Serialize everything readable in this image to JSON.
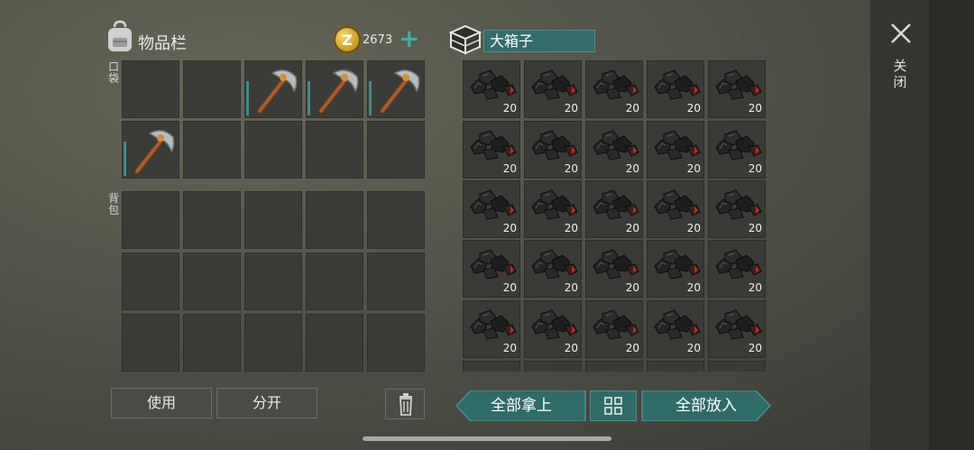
{
  "inventory": {
    "title": "物品栏",
    "bag_icon": "backpack-icon",
    "coins": "2673",
    "coin_symbol": "Z",
    "coin_plus": "+",
    "pocket_label": "口袋",
    "backpack_label": "背包"
  },
  "pockets": [
    {
      "item": null
    },
    {
      "item": null
    },
    {
      "item": "pickaxe"
    },
    {
      "item": "pickaxe"
    },
    {
      "item": "pickaxe"
    },
    {
      "item": "pickaxe"
    },
    {
      "item": null
    },
    {
      "item": null
    },
    {
      "item": null
    },
    {
      "item": null
    }
  ],
  "container": {
    "icon": "crate-icon",
    "name": "大箱子",
    "item": "coal",
    "slots": [
      "20",
      "20",
      "20",
      "20",
      "20",
      "20",
      "20",
      "20",
      "20",
      "20",
      "20",
      "20",
      "20",
      "20",
      "20",
      "20",
      "20",
      "20",
      "20",
      "20",
      "20",
      "20",
      "20",
      "20",
      "20"
    ]
  },
  "buttons": {
    "use": "使用",
    "split": "分开",
    "take_all": "全部拿上",
    "put_all": "全部放入",
    "close": "关闭"
  },
  "colors": {
    "accent_teal": "#2f6b69",
    "durability": "#3f8a88",
    "coin_gold": "#d9a52a"
  }
}
